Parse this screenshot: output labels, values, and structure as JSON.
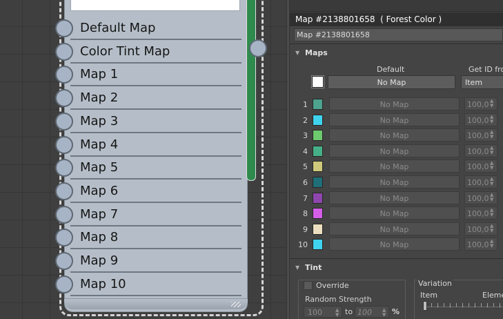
{
  "node": {
    "slots": [
      "Default Map",
      "Color Tint Map",
      "Map 1",
      "Map 2",
      "Map 3",
      "Map 4",
      "Map 5",
      "Map 6",
      "Map 7",
      "Map 8",
      "Map 9",
      "Map 10"
    ],
    "accent_color": "#2f8a4e",
    "body_color": "#b5bec8"
  },
  "panel": {
    "title": "Map #2138801658  ( Forest Color )",
    "name_value": "Map #2138801658",
    "maps_rollout": {
      "label": "Maps",
      "col_default": "Default",
      "col_getid": "Get ID from",
      "default_button": "No Map",
      "getid_value": "Item",
      "rows": [
        {
          "num": "1",
          "color": "#4ea38f",
          "button": "No Map",
          "value": "100,0"
        },
        {
          "num": "2",
          "color": "#3fd3ee",
          "button": "No Map",
          "value": "100,0"
        },
        {
          "num": "3",
          "color": "#6ec86e",
          "button": "No Map",
          "value": "100,0"
        },
        {
          "num": "4",
          "color": "#45b087",
          "button": "No Map",
          "value": "100,0"
        },
        {
          "num": "5",
          "color": "#cec97a",
          "button": "No Map",
          "value": "100,0"
        },
        {
          "num": "6",
          "color": "#1f6f78",
          "button": "No Map",
          "value": "100,0"
        },
        {
          "num": "7",
          "color": "#8e46ae",
          "button": "No Map",
          "value": "100,0"
        },
        {
          "num": "8",
          "color": "#d45ee8",
          "button": "No Map",
          "value": "100,0"
        },
        {
          "num": "9",
          "color": "#ebdfc0",
          "button": "No Map",
          "value": "100,0"
        },
        {
          "num": "10",
          "color": "#3fd3ee",
          "button": "No Map",
          "value": "100,0"
        }
      ]
    },
    "tint_rollout": {
      "label": "Tint",
      "override_label": "Override",
      "random_strength_label": "Random Strength",
      "from_value": "100",
      "to_label": "to",
      "to_value": "100",
      "percent_label": "%",
      "variation_label": "Variation",
      "variation_item": "Item",
      "variation_element": "Element"
    }
  }
}
